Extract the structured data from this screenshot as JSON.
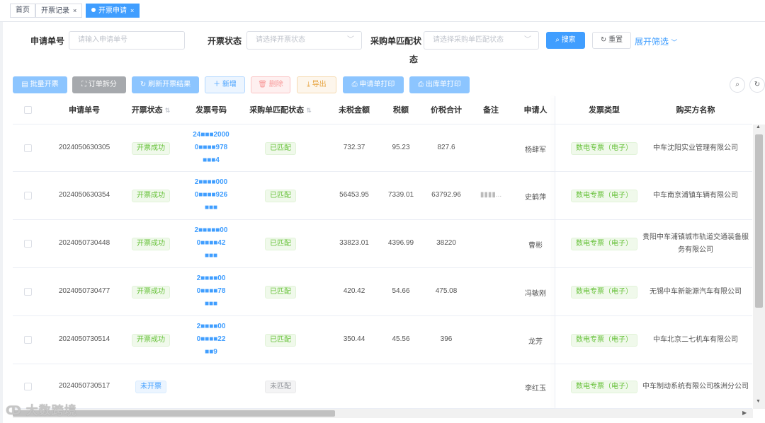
{
  "tabs": [
    {
      "label": "首页",
      "closable": false,
      "active": false
    },
    {
      "label": "开票记录",
      "closable": true,
      "active": false
    },
    {
      "label": "开票申请",
      "closable": true,
      "active": true
    }
  ],
  "filters": {
    "apply_no_label": "申请单号",
    "apply_no_placeholder": "请输入申请单号",
    "status_label": "开票状态",
    "status_placeholder": "请选择开票状态",
    "match_label": "采购单匹配状",
    "match_label2": "态",
    "match_placeholder": "请选择采购单匹配状态",
    "search_label": "搜索",
    "reset_label": "重置",
    "expand_label": "展开筛选"
  },
  "toolbar": {
    "batch_invoice": "批量开票",
    "split_order": "订单拆分",
    "refresh_result": "刷新开票结果",
    "add": "新增",
    "delete": "删除",
    "export": "导出",
    "print_apply": "申请单打印",
    "print_outbound": "出库单打印"
  },
  "table": {
    "columns": [
      "申请单号",
      "开票状态",
      "发票号码",
      "采购单匹配状态",
      "未税金额",
      "税额",
      "价税合计",
      "备注",
      "申请人",
      "发票类型",
      "购买方名称"
    ],
    "rows": [
      {
        "apply_no": "2024050630305",
        "status": "开票成功",
        "invoice_lines": [
          "24■■■2000",
          "0■■■■978",
          "■■■4"
        ],
        "match": "已匹配",
        "untaxed": "732.37",
        "tax": "95.23",
        "total": "827.6",
        "remark": "",
        "applicant": "杨肆军",
        "invoice_type": "数电专票（电子）",
        "buyer": [
          "中车沈阳实业管理有限公司"
        ]
      },
      {
        "apply_no": "2024050630354",
        "status": "开票成功",
        "invoice_lines": [
          "2■■■■000",
          "0■■■■926",
          "■■■"
        ],
        "match": "已匹配",
        "untaxed": "56453.95",
        "tax": "7339.01",
        "total": "63792.96",
        "remark": "▮▮▮▮...",
        "applicant": "史鹤萍",
        "invoice_type": "数电专票（电子）",
        "buyer": [
          "中车南京浦镇车辆有限公司"
        ]
      },
      {
        "apply_no": "2024050730448",
        "status": "开票成功",
        "invoice_lines": [
          "2■■■■■00",
          "0■■■■42",
          "■■■"
        ],
        "match": "已匹配",
        "untaxed": "33823.01",
        "tax": "4396.99",
        "total": "38220",
        "remark": "",
        "applicant": "曹彬",
        "invoice_type": "数电专票（电子）",
        "buyer": [
          "贵阳中车浦镇城市轨道交通装备服",
          "务有限公司"
        ]
      },
      {
        "apply_no": "2024050730477",
        "status": "开票成功",
        "invoice_lines": [
          "2■■■■00",
          "0■■■■78",
          "■■■"
        ],
        "match": "已匹配",
        "untaxed": "420.42",
        "tax": "54.66",
        "total": "475.08",
        "remark": "",
        "applicant": "冯敏刚",
        "invoice_type": "数电专票（电子）",
        "buyer": [
          "无锡中车新能源汽车有限公司"
        ]
      },
      {
        "apply_no": "2024050730514",
        "status": "开票成功",
        "invoice_lines": [
          "2■■■■00",
          "0■■■■22",
          "■■9"
        ],
        "match": "已匹配",
        "untaxed": "350.44",
        "tax": "45.56",
        "total": "396",
        "remark": "",
        "applicant": "龙芳",
        "invoice_type": "数电专票（电子）",
        "buyer": [
          "中车北京二七机车有限公司"
        ]
      },
      {
        "apply_no": "2024050730517",
        "status": "未开票",
        "invoice_lines": [],
        "match": "未匹配",
        "untaxed": "",
        "tax": "",
        "total": "",
        "remark": "",
        "applicant": "李红玉",
        "invoice_type": "数电专票（电子）",
        "buyer": [
          "中车制动系统有限公司株洲分公司"
        ]
      }
    ]
  },
  "watermark": "大数跨境",
  "colors": {
    "primary": "#409eff",
    "success": "#67c23a",
    "warning": "#e6a23c",
    "danger": "#f56c6c"
  }
}
